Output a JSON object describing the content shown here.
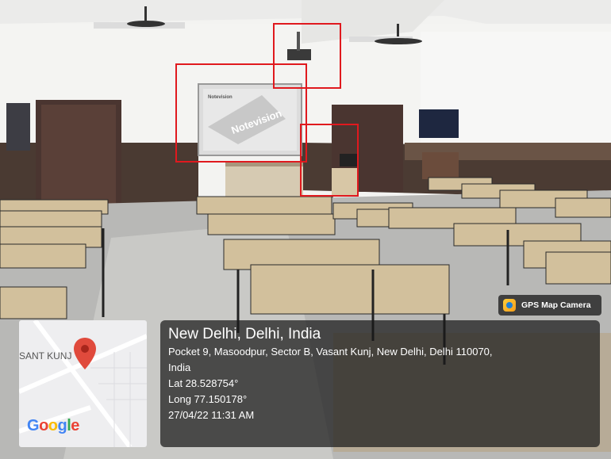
{
  "scene": {
    "description_icon": "classroom-photo",
    "highlight_color": "#e0191e"
  },
  "projection": {
    "logo_text": "Notevision",
    "small_text": "Notevision"
  },
  "app_badge": {
    "label": "GPS Map Camera",
    "icon": "gps-map-camera-icon"
  },
  "map": {
    "area_label": "SANT KUNJ",
    "logo": "Google",
    "logo_colors": [
      "#4285f4",
      "#ea4335",
      "#fbbc05",
      "#4285f4",
      "#34a853",
      "#ea4335"
    ],
    "pin_color": "#e04a3c"
  },
  "location": {
    "city": "New Delhi, Delhi, India",
    "address_line1": "Pocket 9, Masoodpur, Sector B, Vasant Kunj, New Delhi, Delhi 110070,",
    "address_line2": "India",
    "lat": "Lat 28.528754°",
    "long": "Long 77.150178°",
    "datetime": "27/04/22 11:31 AM"
  }
}
